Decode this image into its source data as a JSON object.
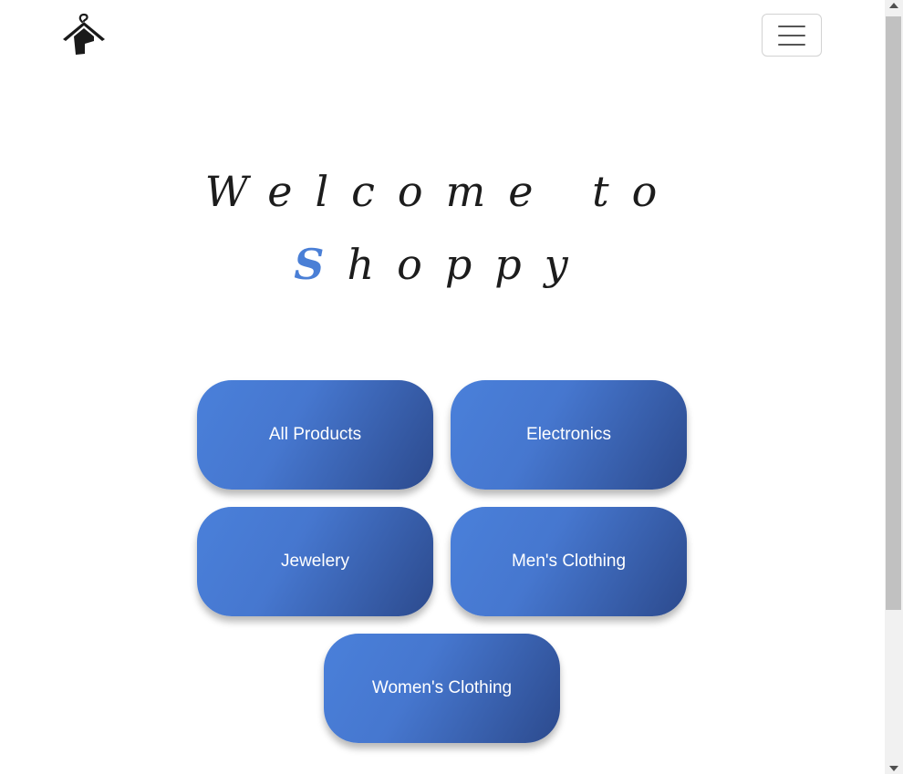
{
  "header": {
    "logo_icon": "hanger-house-icon",
    "menu_icon": "hamburger-menu-icon"
  },
  "hero": {
    "line1": "Welcome to",
    "accent_letter": "S",
    "line2_rest": "hoppy",
    "accent_color": "#4a7fd6"
  },
  "categories": {
    "all_products": "All Products",
    "electronics": "Electronics",
    "jewelery": "Jewelery",
    "mens_clothing": "Men's Clothing",
    "womens_clothing": "Women's Clothing"
  },
  "colors": {
    "button_gradient_start": "#4a80da",
    "button_gradient_end": "#2c4a8d",
    "button_text": "#ffffff"
  }
}
